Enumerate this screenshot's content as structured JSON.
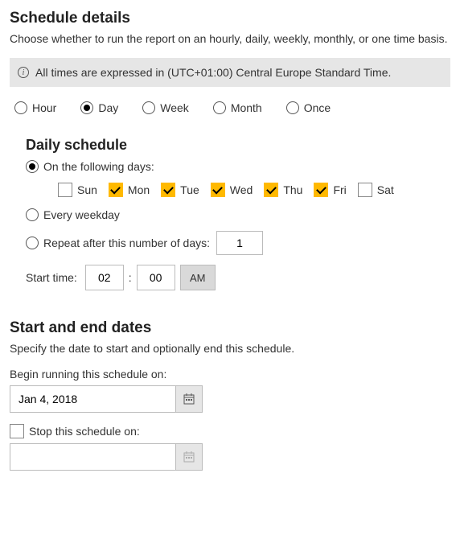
{
  "schedule_details": {
    "heading": "Schedule details",
    "description": "Choose whether to run the report on an hourly, daily, weekly, monthly, or one time basis.",
    "info_text": "All times are expressed in (UTC+01:00) Central Europe Standard Time."
  },
  "frequency": {
    "options": {
      "hour": "Hour",
      "day": "Day",
      "week": "Week",
      "month": "Month",
      "once": "Once"
    },
    "selected": "day"
  },
  "daily": {
    "heading": "Daily schedule",
    "option_following_days": "On the following days:",
    "option_every_weekday": "Every weekday",
    "option_repeat_after": "Repeat after this number of days:",
    "selected_option": "following_days",
    "repeat_days_value": "1",
    "days": {
      "sun": {
        "label": "Sun",
        "checked": false
      },
      "mon": {
        "label": "Mon",
        "checked": true
      },
      "tue": {
        "label": "Tue",
        "checked": true
      },
      "wed": {
        "label": "Wed",
        "checked": true
      },
      "thu": {
        "label": "Thu",
        "checked": true
      },
      "fri": {
        "label": "Fri",
        "checked": true
      },
      "sat": {
        "label": "Sat",
        "checked": false
      }
    },
    "start_time_label": "Start time:",
    "start_hour": "02",
    "start_minute": "00",
    "ampm": "AM"
  },
  "dates": {
    "heading": "Start and end dates",
    "description": "Specify the date to start and optionally end this schedule.",
    "begin_label": "Begin running this schedule on:",
    "begin_value": "Jan 4, 2018",
    "stop_label": "Stop this schedule on:",
    "stop_checked": false,
    "stop_value": ""
  }
}
